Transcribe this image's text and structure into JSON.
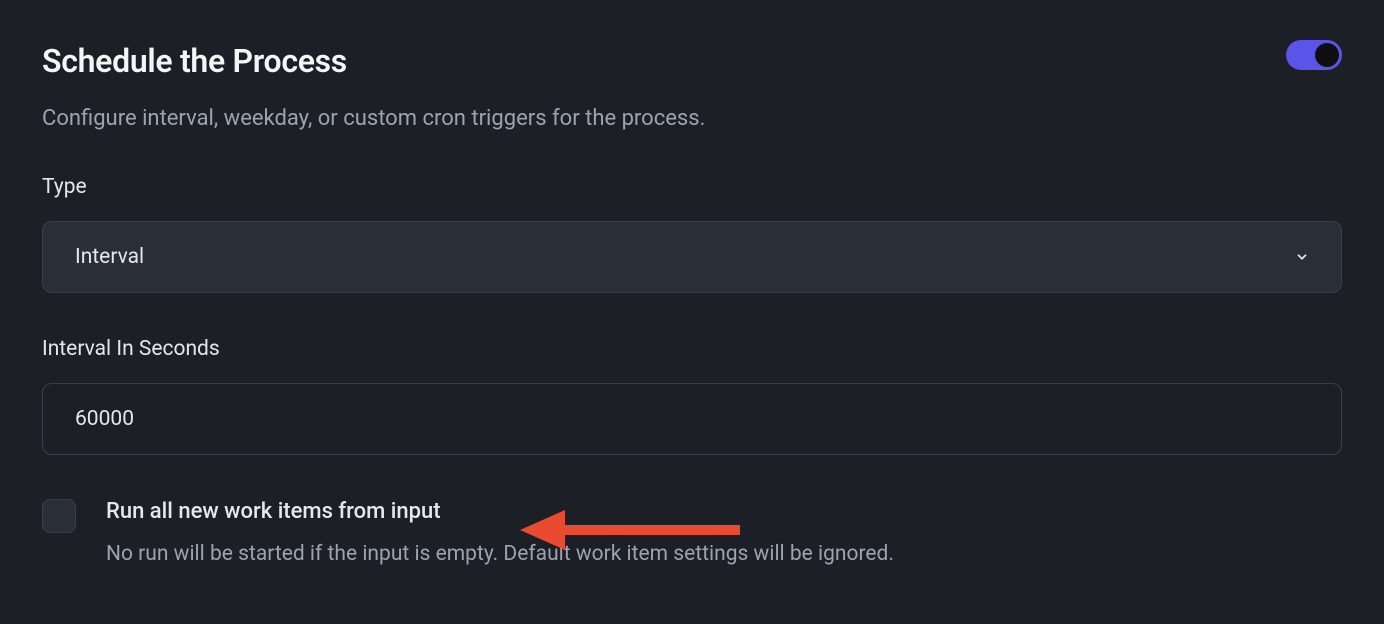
{
  "header": {
    "title": "Schedule the Process",
    "subtitle": "Configure interval, weekday, or custom cron triggers for the process."
  },
  "type_field": {
    "label": "Type",
    "selected": "Interval"
  },
  "interval_field": {
    "label": "Interval In Seconds",
    "value": "60000"
  },
  "run_all_checkbox": {
    "label": "Run all new work items from input",
    "help": "No run will be started if the input is empty. Default work item settings will be ignored."
  }
}
